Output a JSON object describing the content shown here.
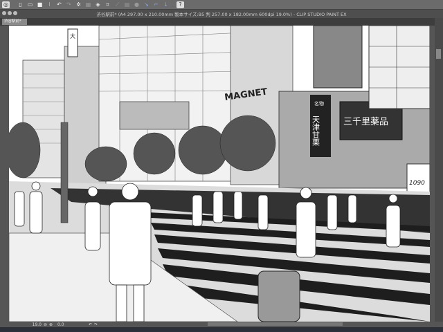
{
  "toolbar": {
    "icons": [
      "clip-studio-icon",
      "new-icon",
      "open-icon",
      "save-icon",
      "undo-icon",
      "redo-icon",
      "settings-icon",
      "transform-icon",
      "fill-icon",
      "crop-icon",
      "ruler-icon",
      "snap-icon",
      "help-icon"
    ],
    "help_label": "?"
  },
  "window": {
    "title": "渋谷駅前* (A4 297.00 x 210.00mm 製本サイズ:B5 判 257.00 x 182.00mm 600dpi 19.0%) - CLIP STUDIO PAINT EX"
  },
  "tab": {
    "label": "渋谷駅前*"
  },
  "canvas": {
    "signs": [
      "MAGNET",
      "天津甘栗",
      "三千里薬品",
      "名物",
      "大",
      "1090"
    ]
  },
  "status": {
    "zoom": "19.0",
    "rotation": "0.0"
  }
}
